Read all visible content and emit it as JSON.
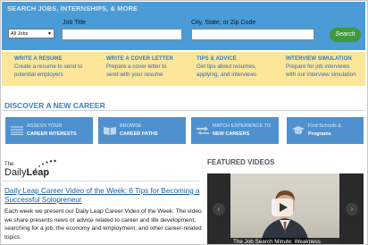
{
  "search": {
    "title": "SEARCH JOBS, INTERNSHIPS, & MORE",
    "job_title_label": "Job Title",
    "location_label": "City, State, or Zip Code",
    "type_select_value": "All Jobs",
    "button_label": "Search"
  },
  "tools": [
    {
      "heading": "WRITE A RESUME",
      "line1": "Create a resume to send to",
      "line2": "potential employers"
    },
    {
      "heading": "WRITE A COVER LETTER",
      "line1": "Prepare a cover letter to",
      "line2": "send with your resume"
    },
    {
      "heading": "TIPS & ADVICE",
      "line1": "Get tips about resumes,",
      "line2": "applying, and interviews"
    },
    {
      "heading": "INTERVIEW SIMULATION",
      "line1": "Prepare for job interviews",
      "line2": "with our interview simulation"
    }
  ],
  "discover": {
    "title": "DISCOVER A NEW CAREER",
    "tiles": [
      {
        "line1": "ASSESS YOUR",
        "line2": "CAREER INTERESTS",
        "icon": "list-icon"
      },
      {
        "line1": "BROWSE",
        "line2": "CAREER PATHS",
        "icon": "book-icon"
      },
      {
        "line1": "MATCH EXPERIENCE TO",
        "line2": "NEW CAREERS",
        "icon": "arrows-icon"
      },
      {
        "line1": "Find Schools &",
        "line2": "Programs",
        "icon": "graduation-icon"
      }
    ]
  },
  "blog": {
    "logo_the": "The",
    "logo_daily": "Daily",
    "logo_leap": "Leap",
    "article_title": "Daily Leap Career Video of the Week: 6 Tips for Becoming a Successful Solopreneur",
    "article_body": "Each week we present our Daily Leap Career Video of the Week. The video we share presents news or advice related to career and life development, searching for a job, the economy and employment, and other career-related topics."
  },
  "videos": {
    "title": "FEATURED VIDEOS",
    "caption": "The Job Search Minute: Weakness"
  },
  "colors": {
    "search_bg": "#4a9bd6",
    "tools_bg": "#fde59a",
    "tile_bg": "#4f91cf",
    "search_button": "#3d9a3d",
    "link": "#1a5fa8"
  }
}
